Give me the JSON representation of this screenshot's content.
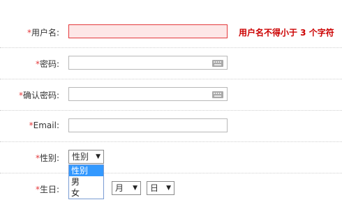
{
  "form": {
    "username": {
      "required_mark": "*",
      "label": "用户名:",
      "value": "",
      "error": "用户名不得小于 3 个字符"
    },
    "password": {
      "required_mark": "*",
      "label": "密码:",
      "value": ""
    },
    "confirm_password": {
      "required_mark": "*",
      "label": "确认密码:",
      "value": ""
    },
    "email": {
      "required_mark": "*",
      "label": "Email:",
      "value": ""
    },
    "gender": {
      "required_mark": "*",
      "label": "性别:",
      "selected": "性别",
      "options": [
        "性别",
        "男",
        "女"
      ]
    },
    "birthday": {
      "required_mark": "*",
      "label": "生日:",
      "month_selected": "月",
      "day_selected": "日"
    }
  },
  "colors": {
    "required": "#e4393c",
    "error_text": "#cc0000",
    "error_field_bg": "#fde7e7",
    "option_highlight": "#3399ff"
  },
  "icons": {
    "keyboard": "keyboard-icon",
    "select_arrow": "▼"
  }
}
